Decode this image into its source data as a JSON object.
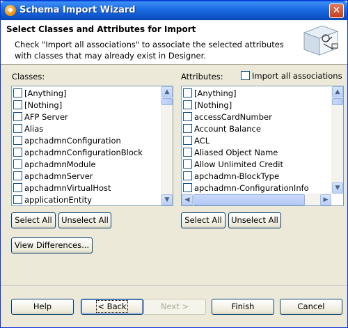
{
  "window": {
    "title": "Schema Import Wizard",
    "close_label": "✕"
  },
  "header": {
    "title": "Select Classes and Attributes for Import",
    "description": "Check \"Import all associations\" to associate the selected attributes with classes that may already exist in Designer."
  },
  "classes": {
    "label": "Classes:",
    "items": [
      "[Anything]",
      "[Nothing]",
      "AFP Server",
      "Alias",
      "apchadmnConfiguration",
      "apchadmnConfigurationBlock",
      "apchadmnModule",
      "apchadmnServer",
      "apchadmnVirtualHost",
      "applicationEntity"
    ],
    "select_all": "Select All",
    "unselect_all": "Unselect All"
  },
  "attributes": {
    "label": "Attributes:",
    "import_all_label": "Import all associations",
    "import_all_checked": false,
    "items": [
      "[Anything]",
      "[Nothing]",
      "accessCardNumber",
      "Account Balance",
      "ACL",
      "Aliased Object Name",
      "Allow Unlimited Credit",
      "apchadmn-BlockType",
      "apchadmn-ConfigurationInfo"
    ],
    "select_all": "Select All",
    "unselect_all": "Unselect All"
  },
  "view_differences": "View Differences...",
  "footer": {
    "help": "Help",
    "back": "< Back",
    "next": "Next >",
    "finish": "Finish",
    "cancel": "Cancel"
  }
}
